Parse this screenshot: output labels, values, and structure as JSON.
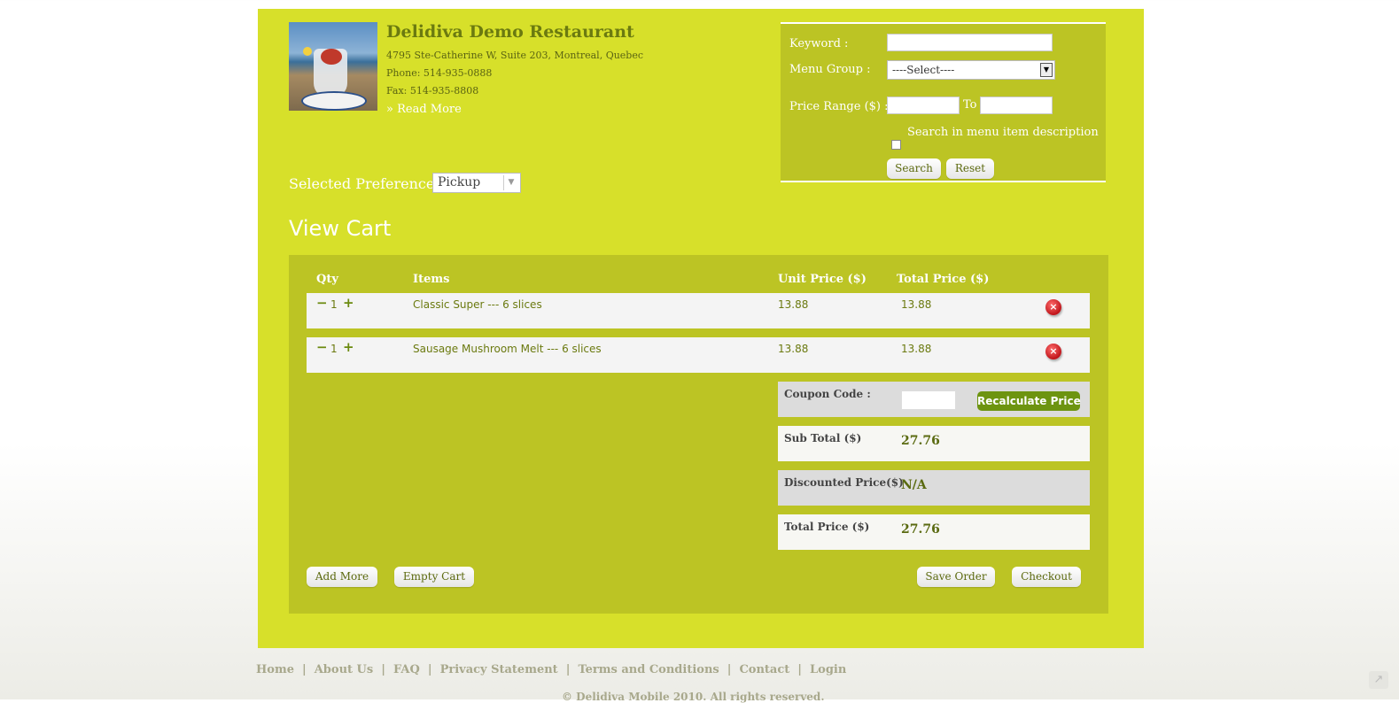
{
  "restaurant": {
    "name": "Delidiva Demo Restaurant",
    "address": "4795 Ste-Catherine W, Suite 203, Montreal, Quebec",
    "phone": "Phone: 514-935-0888",
    "fax": "Fax: 514-935-8808",
    "read_more": "» Read More"
  },
  "search": {
    "keyword_label": "Keyword :",
    "menu_group_label": "Menu Group :",
    "menu_group_selected": "----Select----",
    "price_range_label": "Price Range ($) :",
    "to_label": "To",
    "description_checkbox_label": "Search in menu item description",
    "search_button": "Search",
    "reset_button": "Reset"
  },
  "preference": {
    "label": "Selected Preference :",
    "selected": "Pickup"
  },
  "cart": {
    "title": "View Cart",
    "headers": {
      "qty": "Qty",
      "items": "Items",
      "unit_price": "Unit Price ($)",
      "total_price": "Total Price ($)"
    },
    "rows": [
      {
        "qty": "1",
        "item": "Classic Super --- 6 slices",
        "unit_price": "13.88",
        "total_price": "13.88"
      },
      {
        "qty": "1",
        "item": "Sausage Mushroom Melt --- 6 slices",
        "unit_price": "13.88",
        "total_price": "13.88"
      }
    ],
    "qty_minus": "−",
    "qty_plus": "+",
    "remove_glyph": "×",
    "coupon_label": "Coupon Code :",
    "recalculate_button": "Recalculate Price",
    "subtotal_label": "Sub Total ($)",
    "subtotal_value": "27.76",
    "discounted_label": "Discounted Price($)",
    "discounted_value": "N/A",
    "total_label": "Total Price ($)",
    "total_value": "27.76",
    "add_more_button": "Add More",
    "empty_cart_button": "Empty Cart",
    "save_order_button": "Save Order",
    "checkout_button": "Checkout"
  },
  "footer": {
    "links": [
      "Home",
      "About Us",
      "FAQ",
      "Privacy Statement",
      "Terms and Conditions",
      "Contact",
      "Login"
    ],
    "separator": "|",
    "copyright": "© Delidiva Mobile 2010. All rights reserved."
  },
  "colors": {
    "page_background": "#d7e02a",
    "panel": "#bcc424",
    "accent_green": "#6d9410",
    "remove_red": "#c0151b"
  },
  "icons": {
    "remove": "remove-icon",
    "share": "share-icon",
    "dropdown": "chevron-down-icon"
  }
}
